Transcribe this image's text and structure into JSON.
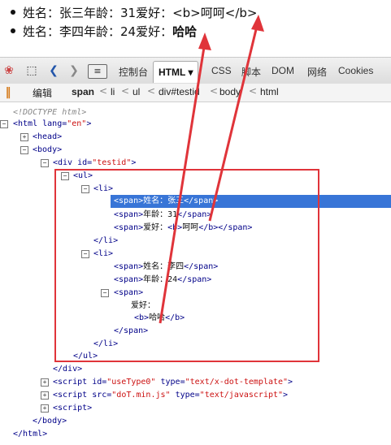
{
  "rendered_list": [
    {
      "text_before": "姓名：张三年龄：31爱好：",
      "text_bold": "",
      "text_raw": "<b>呵呵</b>"
    },
    {
      "text_before": "姓名：李四年龄：24爱好：",
      "text_bold": "哈哈",
      "text_raw": ""
    }
  ],
  "toolbar": {
    "tabs": [
      "控制台",
      "HTML",
      "CSS",
      "脚本",
      "DOM",
      "网络",
      "Cookies"
    ],
    "active_tab_arrow": "▾"
  },
  "breadcrumb": {
    "edit_label": "编辑",
    "items": [
      "span",
      "li",
      "ul",
      "div#testid",
      "body",
      "html"
    ],
    "separator": "<"
  },
  "tree": {
    "doctype": "<!DOCTYPE html>",
    "html_open": "<html",
    "html_lang_attr": "lang=",
    "html_lang_val": "\"en\"",
    "html_close_bracket": ">",
    "head": "<head>",
    "body_open": "<body>",
    "div_open": "<div",
    "div_id_attr": "id=",
    "div_id_val": "\"testid\"",
    "ul_open": "<ul>",
    "li_open": "<li>",
    "li_close": "</li>",
    "ul_close": "</ul>",
    "div_close": "</div>",
    "span_open": "<span>",
    "span_close": "</span>",
    "b_open": "<b>",
    "b_close": "</b>",
    "li1": {
      "name": "姓名：张三",
      "age": "年龄：31",
      "hobby_label": "爱好：",
      "hobby": "呵呵"
    },
    "li2": {
      "name": "姓名：李四",
      "age": "年龄：24",
      "hobby_label": "爱好：",
      "hobby": "哈哈"
    },
    "script1_open": "<script",
    "script1_id_attr": "id=",
    "script1_id_val": "\"useType0\"",
    "script1_type_attr": "type=",
    "script1_type_val": "\"text/x-dot-template\"",
    "script2_src_attr": "src=",
    "script2_src_val": "\"doT.min.js\"",
    "script2_type_attr": "type=",
    "script2_type_val": "\"text/javascript\"",
    "script3": "<script>",
    "body_close": "</body>",
    "html_close": "</html>"
  },
  "colors": {
    "selection": "#3875d7",
    "annotation_red": "#e0343a",
    "tag": "#000088",
    "attr_value": "#cc1111"
  }
}
